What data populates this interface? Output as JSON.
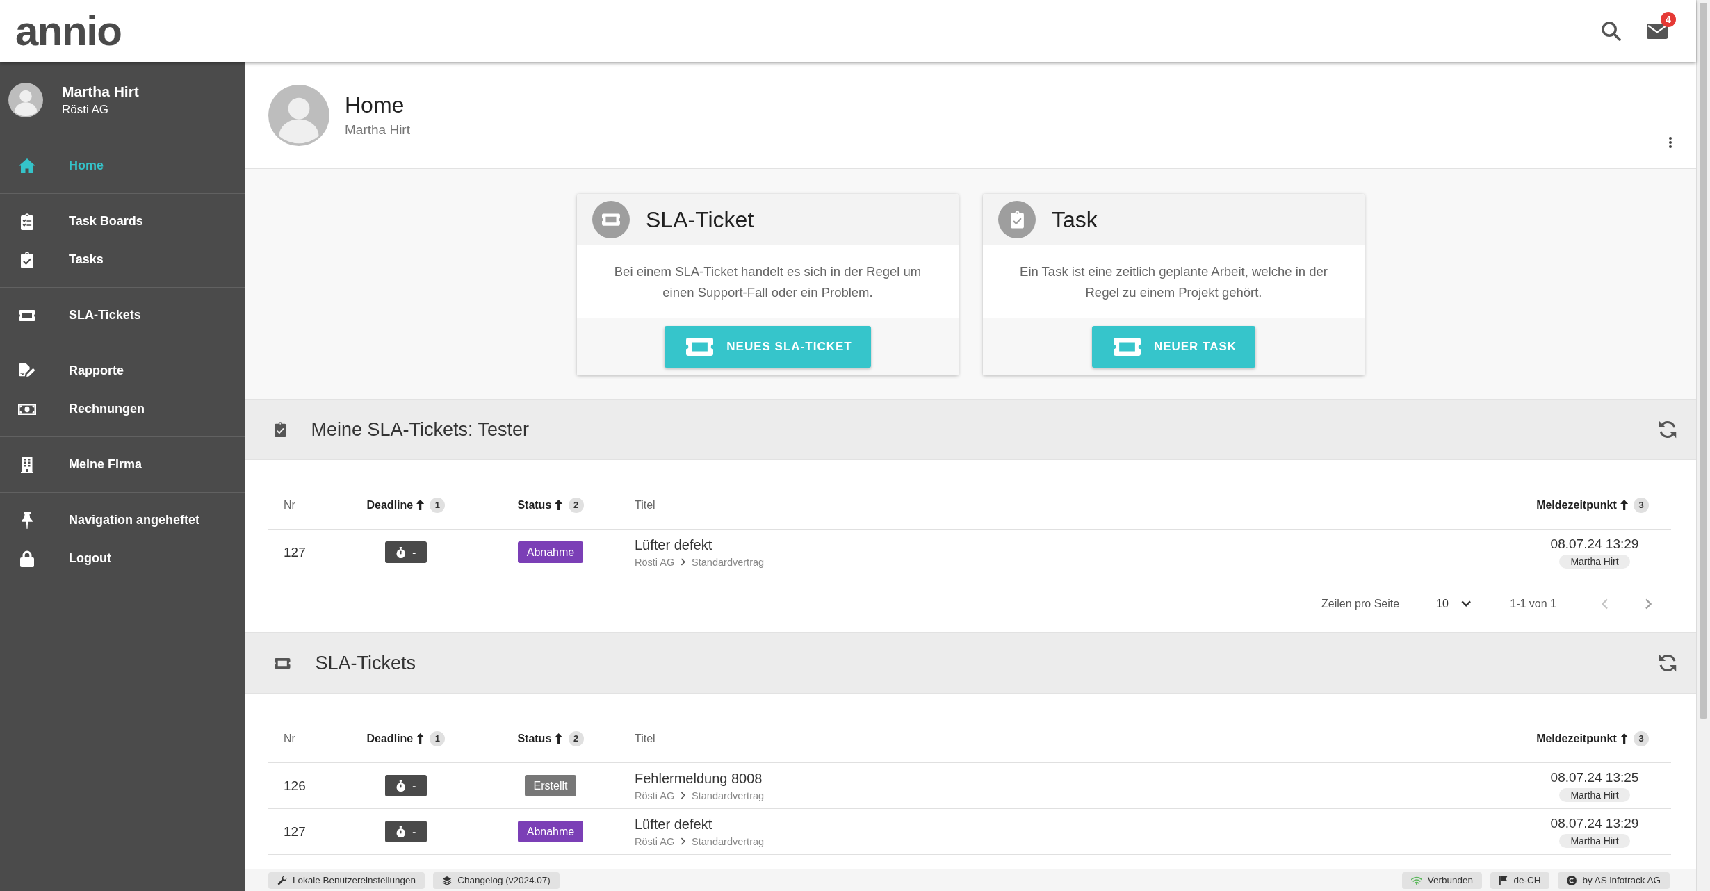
{
  "header": {
    "logo": "annio",
    "notification_count": "4"
  },
  "sidebar": {
    "user": {
      "name": "Martha Hirt",
      "company": "Rösti AG"
    },
    "groups": [
      {
        "items": [
          {
            "label": "Home",
            "selected": true
          }
        ]
      },
      {
        "items": [
          {
            "label": "Task Boards",
            "selected": false
          },
          {
            "label": "Tasks",
            "selected": false
          }
        ]
      },
      {
        "items": [
          {
            "label": "SLA-Tickets",
            "selected": false
          }
        ]
      },
      {
        "items": [
          {
            "label": "Rapporte",
            "selected": false
          },
          {
            "label": "Rechnungen",
            "selected": false
          }
        ]
      },
      {
        "items": [
          {
            "label": "Meine Firma",
            "selected": false
          }
        ]
      },
      {
        "items": [
          {
            "label": "Navigation angeheftet",
            "selected": false
          },
          {
            "label": "Logout",
            "selected": false
          }
        ]
      }
    ]
  },
  "page_header": {
    "title": "Home",
    "subtitle": "Martha Hirt"
  },
  "cards": [
    {
      "title": "SLA-Ticket",
      "text": "Bei einem SLA-Ticket handelt es sich in der Regel um einen Support-Fall oder ein Problem.",
      "button": "NEUES SLA-TICKET"
    },
    {
      "title": "Task",
      "text": "Ein Task ist eine zeitlich geplante Arbeit, welche in der Regel zu einem Projekt gehört.",
      "button": "NEUER TASK"
    }
  ],
  "sections": [
    {
      "title": "Meine SLA-Tickets: Tester",
      "table": {
        "columns": [
          {
            "label": "Nr",
            "sorted": false
          },
          {
            "label": "Deadline",
            "sorted": true,
            "sort_rank": "1"
          },
          {
            "label": "Status",
            "sorted": true,
            "sort_rank": "2"
          },
          {
            "label": "Titel",
            "sorted": false
          },
          {
            "label": "Meldezeitpunkt",
            "sorted": true,
            "sort_rank": "3"
          }
        ],
        "rows": [
          {
            "nr": "127",
            "deadline": "-",
            "status": "Abnahme",
            "color": "#7b3fb6",
            "title": "Lüfter defekt",
            "customer": "Rösti AG",
            "contract": "Standardvertrag",
            "reported": "08.07.24 13:29",
            "reporter": "Martha Hirt"
          }
        ]
      },
      "pagination": {
        "label": "Zeilen pro Seite",
        "rows_per_page": "10",
        "range": "1-1 von 1"
      }
    },
    {
      "title": "SLA-Tickets",
      "table": {
        "columns": [
          {
            "label": "Nr",
            "sorted": false
          },
          {
            "label": "Deadline",
            "sorted": true,
            "sort_rank": "1"
          },
          {
            "label": "Status",
            "sorted": true,
            "sort_rank": "2"
          },
          {
            "label": "Titel",
            "sorted": false
          },
          {
            "label": "Meldezeitpunkt",
            "sorted": true,
            "sort_rank": "3"
          }
        ],
        "rows": [
          {
            "nr": "126",
            "deadline": "-",
            "status": "Erstellt",
            "color": "#777777",
            "title": "Fehlermeldung 8008",
            "customer": "Rösti AG",
            "contract": "Standardvertrag",
            "reported": "08.07.24 13:25",
            "reporter": "Martha Hirt"
          },
          {
            "nr": "127",
            "deadline": "-",
            "status": "Abnahme",
            "color": "#7b3fb6",
            "title": "Lüfter defekt",
            "customer": "Rösti AG",
            "contract": "Standardvertrag",
            "reported": "08.07.24 13:29",
            "reporter": "Martha Hirt"
          }
        ]
      }
    }
  ],
  "status_bar": {
    "settings": "Lokale Benutzereinstellungen",
    "changelog": "Changelog (v2024.07)",
    "connection": {
      "label": "Verbunden",
      "connected": true
    },
    "language": "de-CH",
    "vendor": "by AS infotrack AG"
  }
}
